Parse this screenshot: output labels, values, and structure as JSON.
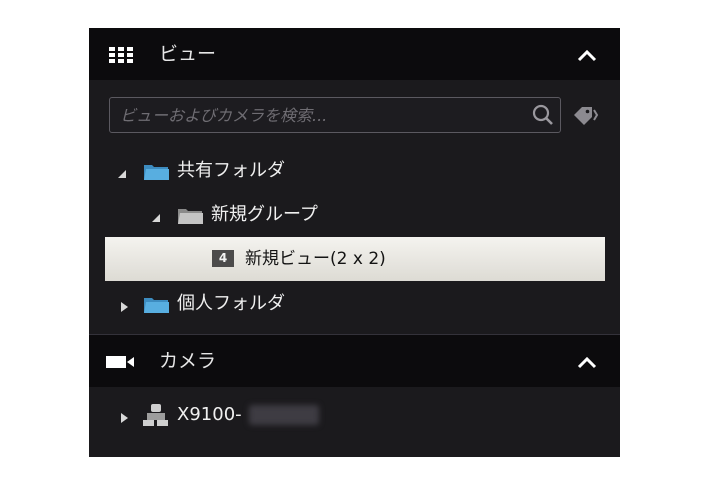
{
  "views_section": {
    "title": "ビュー",
    "icon": "grid-icon",
    "collapse_icon": "chevron-up-icon"
  },
  "search": {
    "placeholder": "ビューおよびカメラを検索...",
    "value": "",
    "icon": "search-icon",
    "tag_icon": "tag-icon"
  },
  "tree": {
    "shared_folder": {
      "label": "共有フォルダ",
      "expanded": true
    },
    "new_group": {
      "label": "新規グループ",
      "expanded": true
    },
    "new_view": {
      "label": "新規ビュー(2 x 2)",
      "badge": "4",
      "selected": true
    },
    "private_folder": {
      "label": "個人フォルダ",
      "expanded": false
    }
  },
  "cameras_section": {
    "title": "カメラ",
    "icon": "camera-icon",
    "collapse_icon": "chevron-up-icon",
    "items": [
      {
        "label": "X9100-",
        "icon": "camera-group-icon",
        "expanded": false
      }
    ]
  },
  "colors": {
    "panel_bg": "#1b1a1d",
    "header_bg": "#0c0b0d",
    "selected_bg": "#e9e7e1",
    "folder_blue": "#55a9d8"
  }
}
